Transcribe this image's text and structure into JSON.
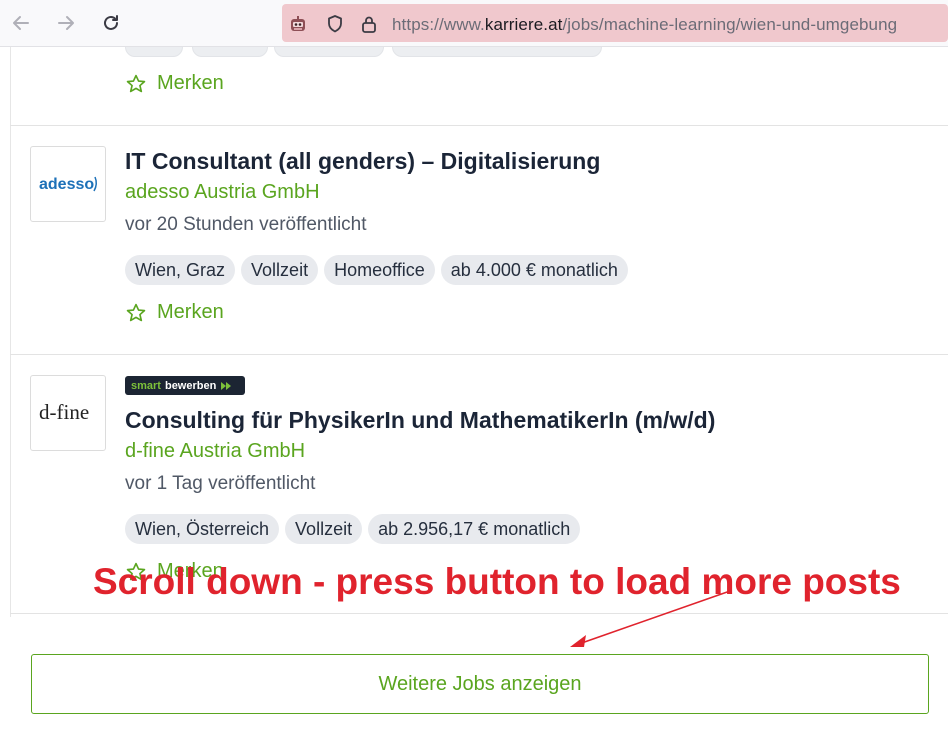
{
  "browser": {
    "url_prefix": "https://www.",
    "url_host": "karriere.at",
    "url_path": "/jobs/machine-learning/wien-und-umgebung"
  },
  "bookmark_label": "Merken",
  "jobs": [
    {
      "title": "IT Consultant (all genders) – Digitalisierung",
      "company": "adesso Austria GmbH",
      "posted": "vor 20 Stunden veröffentlicht",
      "logo_text": "adesso",
      "tags": [
        "Wien, Graz",
        "Vollzeit",
        "Homeoffice",
        "ab 4.000 € monatlich"
      ]
    },
    {
      "badge_part1": "smart",
      "badge_part2": "bewerben",
      "title": "Consulting für PhysikerIn und MathematikerIn (m/w/d)",
      "company": "d-fine Austria GmbH",
      "posted": "vor 1 Tag veröffentlicht",
      "logo_text": "d-fine",
      "tags": [
        "Wien, Österreich",
        "Vollzeit",
        "ab 2.956,17 € monatlich"
      ]
    }
  ],
  "annotation": "Scroll down - press button to load more posts",
  "load_more_label": "Weitere Jobs anzeigen",
  "colors": {
    "accent_green": "#5aa51f",
    "annotation_red": "#e0232d",
    "urlbar_bg": "#f0c8cd"
  }
}
